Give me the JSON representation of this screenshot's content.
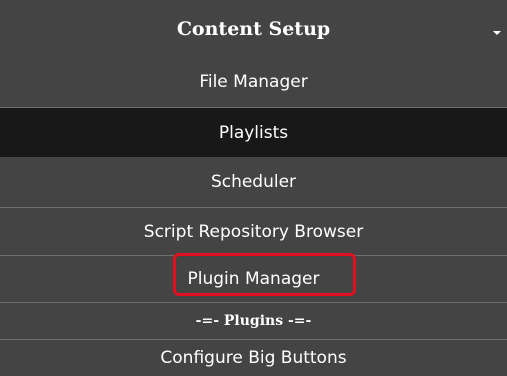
{
  "menu": {
    "title": "Content Setup",
    "items": [
      {
        "label": "File Manager"
      },
      {
        "label": "Playlists",
        "selected": true
      },
      {
        "label": "Scheduler"
      },
      {
        "label": "Script Repository Browser"
      },
      {
        "label": "Plugin Manager",
        "highlighted": true
      }
    ],
    "section_header": "-=- Plugins -=-",
    "plugin_items": [
      {
        "label": "Configure Big Buttons"
      }
    ]
  },
  "colors": {
    "menu_background": "#444444",
    "selected_background": "#181818",
    "separator": "#6f6f6f",
    "highlight_border": "#e01020",
    "text": "#ffffff"
  }
}
